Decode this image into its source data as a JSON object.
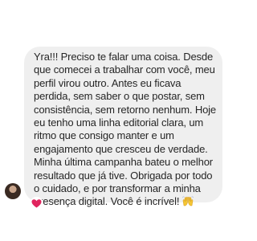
{
  "conversation": {
    "message": {
      "text": "Yra!!! Preciso te falar uma coisa. Desde\nque comecei a trabalhar com você, meu\nperfil virou outro. Antes eu ficava\nperdida, sem saber o que postar, sem\nconsistência, sem retorno nenhum. Hoje\neu tenho uma linha editorial clara, um\nritmo que consigo manter e um\nengajamento que cresceu de verdade.\nMinha última campanha bateu o melhor\nresultado que já tive. Obrigada por todo\no cuidado, e por transformar a minha\npresença digital. Você é incrível!",
      "trailing_emoji": "raising-hands-icon",
      "reaction": "red-heart-icon"
    }
  },
  "colors": {
    "bubble": "#efefef",
    "text": "#262626",
    "heart": "#e0245e",
    "hands": "#f4c534"
  }
}
